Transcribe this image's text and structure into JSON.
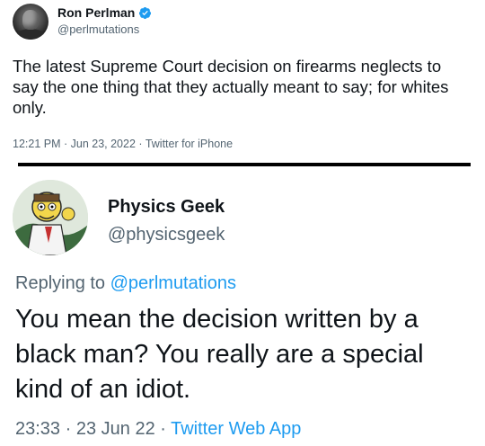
{
  "tweet1": {
    "display_name": "Ron Perlman",
    "handle": "@perlmutations",
    "text": "The latest Supreme Court decision on firearms neglects to say the one thing that they actually meant to say; for whites only.",
    "time": "12:21 PM",
    "date": "Jun 23, 2022",
    "source": "Twitter for iPhone",
    "separator": " · ",
    "verified_color": "#1d9bf0"
  },
  "tweet2": {
    "display_name": "Physics Geek",
    "handle": "@physicsgeek",
    "replying_prefix": "Replying to ",
    "replying_to": "@perlmutations",
    "text": "You mean the decision written by a black man? You really are a special kind of an idiot.",
    "time": "23:33",
    "date": "23 Jun 22",
    "source": "Twitter Web App",
    "separator": " · "
  },
  "colors": {
    "link": "#1d9bf0",
    "secondary_text": "#536471",
    "primary_text": "#0f1419"
  }
}
